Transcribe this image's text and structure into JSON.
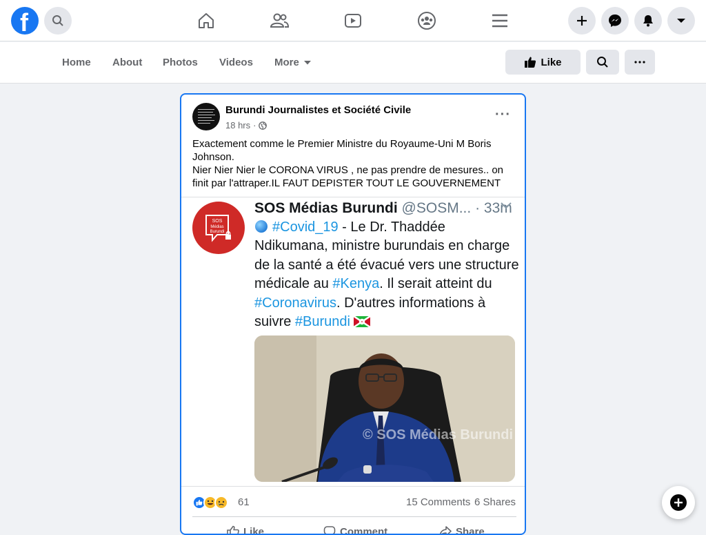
{
  "topbar": {
    "logo_letter": "f",
    "icons": [
      "search-icon",
      "home-icon",
      "friends-icon",
      "watch-icon",
      "groups-icon",
      "menu-icon",
      "create-icon",
      "messenger-icon",
      "notifications-icon",
      "account-chevron-icon"
    ]
  },
  "page_nav": {
    "tabs": [
      "Home",
      "About",
      "Photos",
      "Videos",
      "More"
    ],
    "like_label": "Like"
  },
  "post": {
    "author": "Burundi Journalistes et Société Civile",
    "time": "18 hrs",
    "text_line1": "Exactement comme le Premier Ministre du Royaume-Uni M Boris Johnson.",
    "text_line2": "Nier Nier Nier le CORONA VIRUS , ne pas prendre de mesures.. on finit par l'attraper.IL FAUT DEPISTER TOUT LE GOUVERNEMENT",
    "tweet": {
      "logo_text": "SOS Médias Burundi",
      "name": "SOS Médias Burundi",
      "handle": "@SOSM...",
      "time": "· 33m",
      "body_tag1": "#Covid_19",
      "body_part1": " - Le Dr. Thaddée Ndikumana, ministre burundais en charge de la santé a été évacué vers une structure médicale au ",
      "body_tag2": "#Kenya",
      "body_part2": ". Il serait atteint du ",
      "body_tag3": "#Coronavirus",
      "body_part3": ". D'autres informations à suivre ",
      "body_tag4": "#Burundi",
      "watermark": "© SOS Médias Burundi"
    },
    "reactions_count": "61",
    "comments": "15 Comments",
    "shares": "6 Shares",
    "actions": [
      "Like",
      "Comment",
      "Share"
    ]
  },
  "colors": {
    "brand": "#1877f2",
    "sos_red": "#cf2a27",
    "hashtag": "#1b95e0"
  }
}
